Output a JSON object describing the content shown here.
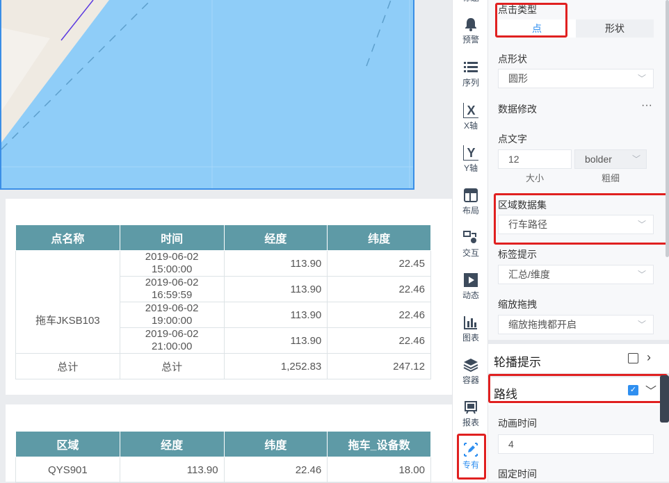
{
  "rail": {
    "items": [
      {
        "name": "rail-item-title",
        "label": "标题",
        "icon": "title-icon"
      },
      {
        "name": "rail-item-alert",
        "label": "预警",
        "icon": "bell-icon"
      },
      {
        "name": "rail-item-series",
        "label": "序列",
        "icon": "list-icon"
      },
      {
        "name": "rail-item-x-axis",
        "label": "X轴",
        "icon": "x-axis-icon"
      },
      {
        "name": "rail-item-y-axis",
        "label": "Y轴",
        "icon": "y-axis-icon"
      },
      {
        "name": "rail-item-layout",
        "label": "布局",
        "icon": "layout-icon"
      },
      {
        "name": "rail-item-interaction",
        "label": "交互",
        "icon": "interaction-icon"
      },
      {
        "name": "rail-item-animation",
        "label": "动态",
        "icon": "play-icon"
      },
      {
        "name": "rail-item-chart",
        "label": "图表",
        "icon": "bar-chart-icon"
      },
      {
        "name": "rail-item-container",
        "label": "容器",
        "icon": "layers-icon"
      },
      {
        "name": "rail-item-report",
        "label": "报表",
        "icon": "report-icon"
      },
      {
        "name": "rail-item-special",
        "label": "专有",
        "icon": "pen-icon"
      }
    ]
  },
  "table1": {
    "headers": [
      "点名称",
      "时间",
      "经度",
      "纬度"
    ],
    "group_name": "拖车JKSB103",
    "rows": [
      {
        "time_date": "2019-06-02",
        "time_clock": "15:00:00",
        "lng": "113.90",
        "lat": "22.45"
      },
      {
        "time_date": "2019-06-02",
        "time_clock": "16:59:59",
        "lng": "113.90",
        "lat": "22.46"
      },
      {
        "time_date": "2019-06-02",
        "time_clock": "19:00:00",
        "lng": "113.90",
        "lat": "22.46"
      },
      {
        "time_date": "2019-06-02",
        "time_clock": "21:00:00",
        "lng": "113.90",
        "lat": "22.46"
      }
    ],
    "total": {
      "name": "总计",
      "time": "总计",
      "lng": "1,252.83",
      "lat": "247.12"
    }
  },
  "table2": {
    "headers": [
      "区域",
      "经度",
      "纬度",
      "拖车_设备数"
    ],
    "rows": [
      {
        "area": "QYS901",
        "lng": "113.90",
        "lat": "22.46",
        "count": "18.00"
      }
    ]
  },
  "settings": {
    "click_type_label": "点击类型",
    "click_type_options": [
      "点",
      "形状"
    ],
    "point_shape_label": "点形状",
    "point_shape_value": "圆形",
    "data_edit_label": "数据修改",
    "point_text_label": "点文字",
    "font_size_value": "12",
    "font_weight_value": "bolder",
    "size_caption": "大小",
    "weight_caption": "粗细",
    "region_dataset_label": "区域数据集",
    "region_dataset_value": "行车路径",
    "tag_tip_label": "标签提示",
    "tag_tip_value": "汇总/维度",
    "zoom_drag_label": "缩放拖拽",
    "zoom_drag_value": "缩放拖拽都开启",
    "carousel_label": "轮播提示",
    "route_label": "路线",
    "anim_time_label": "动画时间",
    "anim_time_value": "4",
    "fixed_time_label": "固定时间"
  },
  "colors": {
    "accent": "#2f8ff0",
    "header": "#5e9aa6",
    "map_water": "#8fcdf8",
    "highlight": "#e02020"
  }
}
